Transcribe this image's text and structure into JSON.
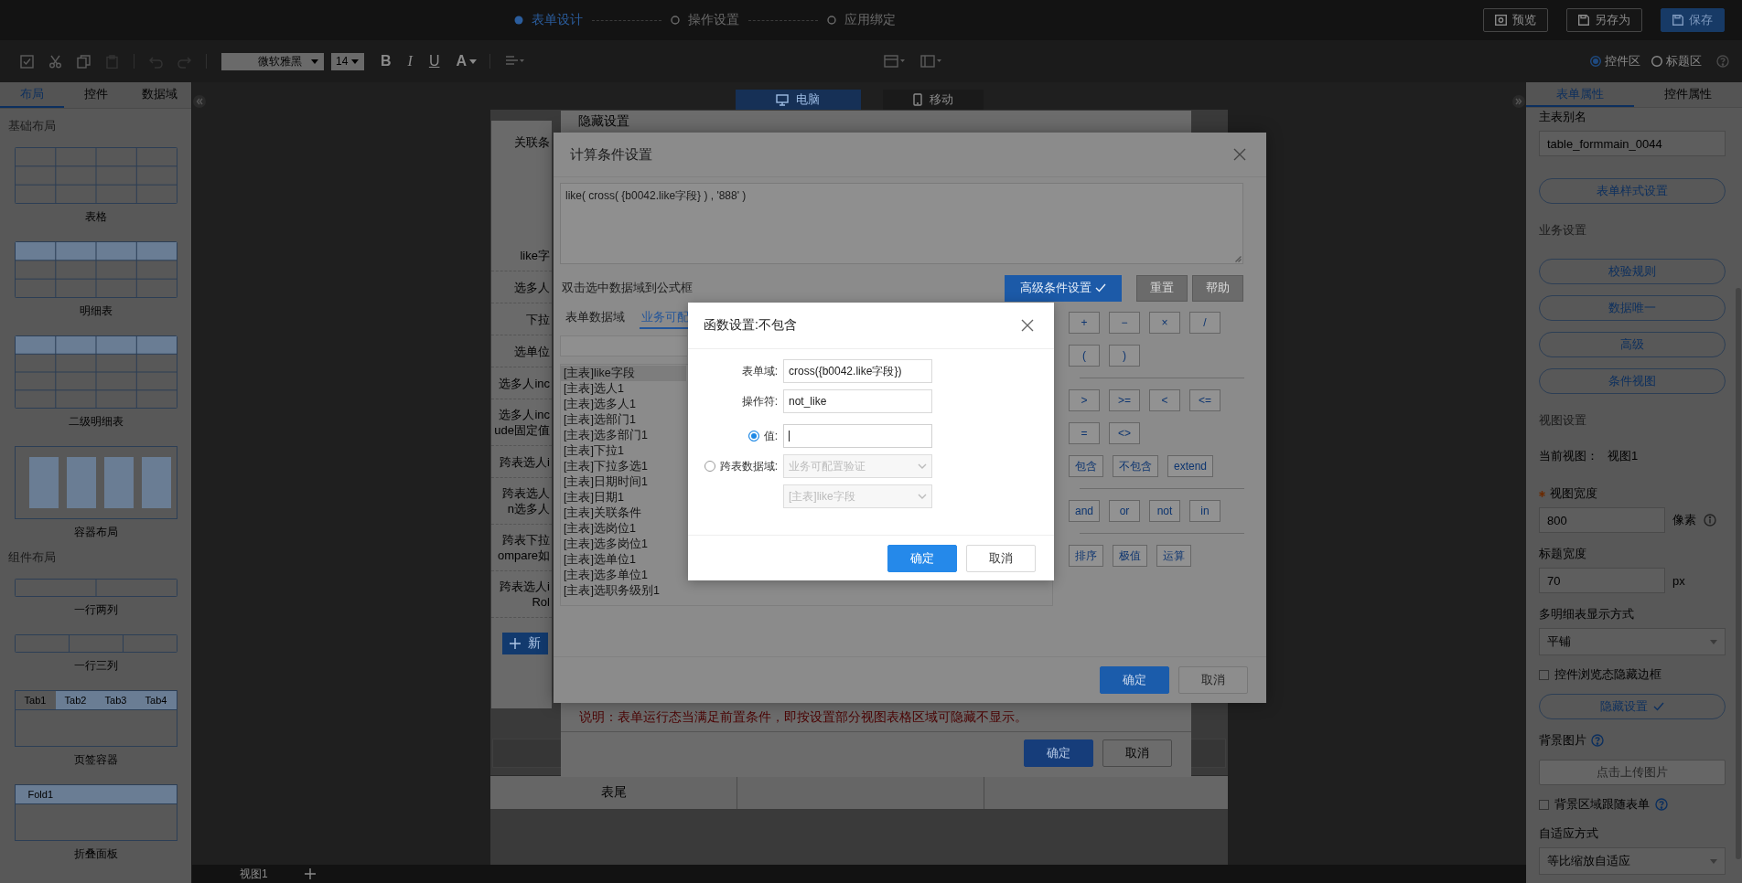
{
  "top_bar": {
    "steps": [
      {
        "label": "表单设计",
        "selected": true
      },
      {
        "label": "操作设置",
        "selected": false
      },
      {
        "label": "应用绑定",
        "selected": false
      }
    ],
    "buttons": [
      {
        "label": "预览",
        "kind": "preview"
      },
      {
        "label": "另存为",
        "kind": "save_as"
      },
      {
        "label": "保存",
        "kind": "save"
      }
    ]
  },
  "toolbar": {
    "font": "微软雅黑",
    "size": "14",
    "format_buttons": [
      "B",
      "I",
      "U",
      "A"
    ],
    "areas": [
      {
        "label": "控件区",
        "selected": true
      },
      {
        "label": "标题区",
        "selected": false
      }
    ]
  },
  "left_panel": {
    "tabs": [
      {
        "label": "布局",
        "selected": true
      },
      {
        "label": "控件",
        "selected": false
      },
      {
        "label": "数据域",
        "selected": false
      }
    ],
    "sections": [
      {
        "title": "基础布局",
        "items": [
          {
            "label": "表格",
            "kind": "table"
          },
          {
            "label": "明细表",
            "kind": "detail"
          },
          {
            "label": "二级明细表",
            "kind": "detail2"
          },
          {
            "label": "容器布局",
            "kind": "container"
          }
        ]
      },
      {
        "title": "组件布局",
        "items": [
          {
            "label": "一行两列",
            "kind": "columns2"
          },
          {
            "label": "一行三列",
            "kind": "columns3"
          },
          {
            "label": "页签容器",
            "kind": "tabs",
            "tabs": [
              "Tab1",
              "Tab2",
              "Tab3",
              "Tab4"
            ]
          },
          {
            "label": "折叠面板",
            "kind": "fold",
            "header": "Fold1"
          }
        ]
      }
    ]
  },
  "canvas": {
    "device_tabs": [
      {
        "label": "电脑",
        "kind": "desktop",
        "selected": true
      },
      {
        "label": "移动",
        "kind": "mobile",
        "selected": false
      }
    ],
    "condition_rows": [
      {
        "lines": [
          "关联条"
        ]
      },
      {
        "lines": [
          "like字"
        ]
      },
      {
        "lines": [
          "选多人"
        ]
      },
      {
        "lines": [
          "下拉"
        ]
      },
      {
        "lines": [
          "选单位"
        ]
      },
      {
        "lines": [
          "选多人inc"
        ]
      },
      {
        "lines": [
          "选多人inc",
          "ude固定值"
        ]
      },
      {
        "lines": [
          "跨表选人i"
        ]
      },
      {
        "lines": [
          "跨表选人",
          "n选多人"
        ]
      },
      {
        "lines": [
          "跨表下拉",
          "ompare如"
        ]
      },
      {
        "lines": [
          "跨表选人i",
          "Rol"
        ]
      }
    ],
    "add_button": "新",
    "footer_label": "表尾",
    "view_tabs": [
      "视图1"
    ]
  },
  "right_panel": {
    "tabs": [
      {
        "label": "表单属性",
        "selected": true
      },
      {
        "label": "控件属性",
        "selected": false
      }
    ],
    "items": [
      {
        "kind": "label",
        "text": "主表别名"
      },
      {
        "kind": "input",
        "value": "table_formmain_0044"
      },
      {
        "kind": "button",
        "label": "表单样式设置"
      },
      {
        "kind": "section",
        "text": "业务设置"
      },
      {
        "kind": "button",
        "label": "校验规则"
      },
      {
        "kind": "button",
        "label": "数据唯一"
      },
      {
        "kind": "button",
        "label": "高级"
      },
      {
        "kind": "button",
        "label": "条件视图"
      },
      {
        "kind": "section",
        "text": "视图设置"
      },
      {
        "kind": "pair",
        "label": "当前视图：",
        "value": "视图1"
      },
      {
        "kind": "label",
        "text": "视图宽度",
        "required": true
      },
      {
        "kind": "input",
        "value": "800",
        "unit": "像素",
        "info": true
      },
      {
        "kind": "label",
        "text": "标题宽度"
      },
      {
        "kind": "input",
        "value": "70",
        "unit": "px"
      },
      {
        "kind": "label",
        "text": "多明细表显示方式"
      },
      {
        "kind": "select",
        "value": "平铺"
      },
      {
        "kind": "checkbox",
        "label": "控件浏览态隐藏边框",
        "checked": false
      },
      {
        "kind": "button",
        "label": "隐藏设置",
        "check": true
      },
      {
        "kind": "label",
        "text": "背景图片",
        "help": true
      },
      {
        "kind": "button",
        "label": "点击上传图片",
        "disabled": true
      },
      {
        "kind": "checkbox",
        "label": "背景区域跟随表单",
        "checked": false,
        "help": true
      },
      {
        "kind": "label",
        "text": "自适应方式"
      },
      {
        "kind": "select",
        "value": "等比缩放自适应"
      }
    ]
  },
  "hide_dialog": {
    "title": "隐藏设置",
    "note": "说明：表单运行态当满足前置条件，即按设置部分视图表格区域可隐藏不显示。",
    "buttons": [
      {
        "label": "确定",
        "kind": "primary"
      },
      {
        "label": "取消",
        "kind": "default"
      }
    ]
  },
  "calc_dialog": {
    "title": "计算条件设置",
    "formula": "like( cross( {b0042.like字段} ) , '888' )",
    "hint": "双击选中数据域到公式框",
    "actions": [
      {
        "label": "高级条件设置",
        "kind": "primary",
        "check": true
      },
      {
        "label": "重置",
        "kind": "gray"
      },
      {
        "label": "帮助",
        "kind": "gray"
      }
    ],
    "tabs": [
      {
        "label": "表单数据域",
        "selected": false
      },
      {
        "label": "业务可配",
        "selected": true
      }
    ],
    "fields": [
      {
        "label": "[主表]like字段",
        "selected": true
      },
      {
        "label": "[主表]选人1",
        "selected": false
      },
      {
        "label": "[主表]选多人1",
        "selected": false
      },
      {
        "label": "[主表]选部门1",
        "selected": false
      },
      {
        "label": "[主表]选多部门1",
        "selected": false
      },
      {
        "label": "[主表]下拉1",
        "selected": false
      },
      {
        "label": "[主表]下拉多选1",
        "selected": false
      },
      {
        "label": "[主表]日期时间1",
        "selected": false
      },
      {
        "label": "[主表]日期1",
        "selected": false
      },
      {
        "label": "[主表]关联条件",
        "selected": false
      },
      {
        "label": "[主表]选岗位1",
        "selected": false
      },
      {
        "label": "[主表]选多岗位1",
        "selected": false
      },
      {
        "label": "[主表]选单位1",
        "selected": false
      },
      {
        "label": "[主表]选多单位1",
        "selected": false
      },
      {
        "label": "[主表]选职务级别1",
        "selected": false
      }
    ],
    "operator_groups": [
      [
        [
          "+",
          "−",
          "×",
          "/"
        ],
        [
          "(",
          ")"
        ]
      ],
      [
        [
          ">",
          ">=",
          "<",
          "<="
        ],
        [
          "=",
          "<>"
        ],
        [
          "包含",
          "不包含",
          "extend"
        ]
      ],
      [
        [
          "and",
          "or",
          "not",
          "in"
        ]
      ],
      [
        [
          "排序",
          "极值",
          "运算"
        ]
      ]
    ],
    "buttons": [
      {
        "label": "确定",
        "kind": "primary"
      },
      {
        "label": "取消",
        "kind": "default"
      }
    ]
  },
  "func_dialog": {
    "title": "函数设置:不包含",
    "fields": [
      {
        "label": "表单域:",
        "value": "cross({b0042.like字段})"
      },
      {
        "label": "操作符:",
        "value": "not_like"
      }
    ],
    "options": [
      {
        "label": "值:",
        "kind": "input",
        "selected": true
      },
      {
        "label": "跨表数据域:",
        "kind": "selects",
        "selected": false,
        "selects": [
          "业务可配置验证",
          "[主表]like字段"
        ]
      }
    ],
    "buttons": [
      {
        "label": "确定",
        "kind": "primary"
      },
      {
        "label": "取消",
        "kind": "default"
      }
    ]
  }
}
